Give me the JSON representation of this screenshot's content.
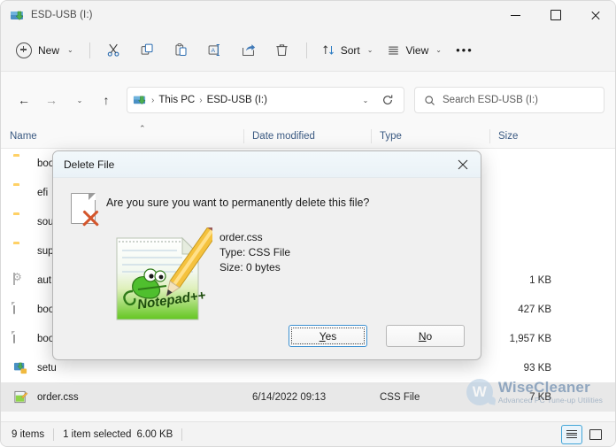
{
  "window": {
    "title": "ESD-USB (I:)",
    "icon": "usb-drive-icon",
    "minimize_label": "Minimize",
    "maximize_label": "Maximize",
    "close_label": "Close"
  },
  "toolbar": {
    "new_label": "New",
    "new_chevron": "⌄",
    "items": [
      {
        "name": "cut-button",
        "icon": "scissors-icon"
      },
      {
        "name": "copy-button",
        "icon": "copy-icon"
      },
      {
        "name": "paste-button",
        "icon": "paste-icon"
      },
      {
        "name": "rename-button",
        "icon": "rename-icon"
      },
      {
        "name": "share-button",
        "icon": "share-icon"
      },
      {
        "name": "delete-button",
        "icon": "trash-icon"
      }
    ],
    "sort_label": "Sort",
    "view_label": "View",
    "more_label": "•••"
  },
  "navigation": {
    "back": "←",
    "forward": "→",
    "recent": "⌄",
    "up": "↑"
  },
  "address": {
    "drive_icon": "usb-drive-icon",
    "crumbs": [
      "This PC",
      "ESD-USB (I:)"
    ],
    "separator": "›",
    "dropdown": "⌄",
    "refresh": "⟳"
  },
  "search": {
    "placeholder": "Search ESD-USB (I:)",
    "icon": "search-icon"
  },
  "columns": [
    {
      "key": "name",
      "label": "Name"
    },
    {
      "key": "date",
      "label": "Date modified"
    },
    {
      "key": "type",
      "label": "Type"
    },
    {
      "key": "size",
      "label": "Size"
    }
  ],
  "sort_indicator": "⌃",
  "files": [
    {
      "icon": "folder-icon",
      "name": "boo",
      "date": "",
      "type": "",
      "size": "",
      "selected": false
    },
    {
      "icon": "folder-icon",
      "name": "efi",
      "date": "",
      "type": "",
      "size": "",
      "selected": false
    },
    {
      "icon": "folder-icon",
      "name": "sou",
      "date": "",
      "type": "",
      "size": "",
      "selected": false
    },
    {
      "icon": "folder-icon",
      "name": "sup",
      "date": "",
      "type": "",
      "size": "",
      "selected": false
    },
    {
      "icon": "config-icon",
      "name": "aut",
      "date": "",
      "type": "",
      "size": "1 KB",
      "selected": false
    },
    {
      "icon": "file-icon",
      "name": "boo",
      "date": "",
      "type": "",
      "size": "427 KB",
      "selected": false
    },
    {
      "icon": "file-icon",
      "name": "boo",
      "date": "",
      "type": "",
      "size": "1,957 KB",
      "selected": false
    },
    {
      "icon": "setup-icon",
      "name": "setu",
      "date": "",
      "type": "",
      "size": "93 KB",
      "selected": false
    },
    {
      "icon": "css-file-icon",
      "name": "order.css",
      "date": "6/14/2022 09:13",
      "type": "CSS File",
      "size": "7 KB",
      "selected": true
    }
  ],
  "status": {
    "item_count": "9 items",
    "selection": "1 item selected",
    "selection_size": "6.00 KB",
    "details_view_label": "Details view",
    "large_icons_view_label": "Large icons view"
  },
  "watermark": {
    "mark": "W",
    "name": "WiseCleaner",
    "tagline": "Advanced PC Tune-up Utilities"
  },
  "dialog": {
    "title": "Delete File",
    "close_label": "✕",
    "question": "Are you sure you want to permanently delete this file?",
    "file_name": "order.css",
    "file_type": "Type: CSS File",
    "file_size": "Size: 0 bytes",
    "file_icon": "notepad-plus-plus-icon",
    "warning_icon": "document-delete-icon",
    "yes_mnemonic": "Y",
    "yes_rest": "es",
    "no_mnemonic": "N",
    "no_rest": "o"
  },
  "colors": {
    "accent": "#3b8fd0",
    "header_text": "#3b5a82",
    "warning_x": "#d4562c",
    "folder": "#ffd166",
    "watermark": "#5b7fa6"
  }
}
